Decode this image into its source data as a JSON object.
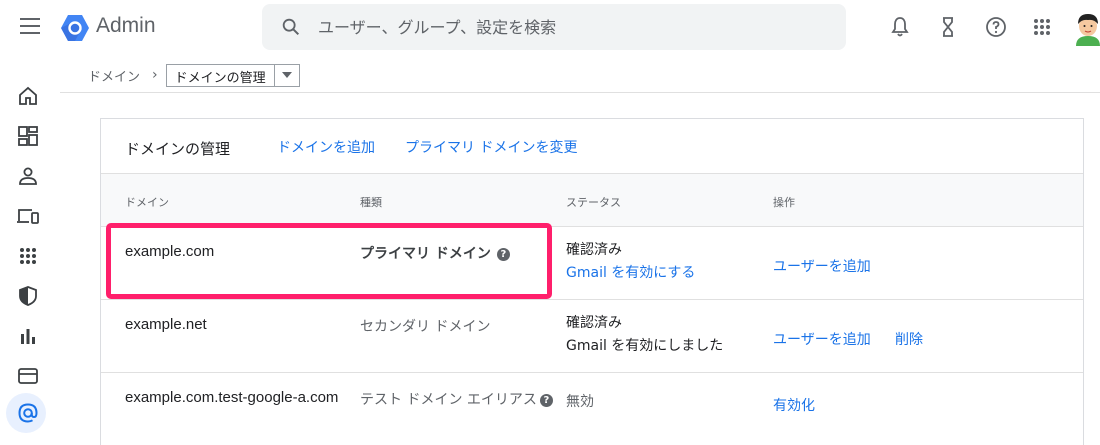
{
  "header": {
    "app_title": "Admin",
    "search_placeholder": "ユーザー、グループ、設定を検索"
  },
  "breadcrumb": {
    "parent": "ドメイン",
    "separator": "›",
    "current": "ドメインの管理"
  },
  "card": {
    "title": "ドメインの管理",
    "add_domain_link": "ドメインを追加",
    "change_primary_link": "プライマリ ドメインを変更"
  },
  "columns": {
    "domain": "ドメイン",
    "type": "種類",
    "status": "ステータス",
    "actions": "操作"
  },
  "rows": [
    {
      "domain": "example.com",
      "type": "プライマリ ドメイン",
      "status": "確認済み",
      "status_link": "Gmail を有効にする",
      "action1": "ユーザーを追加"
    },
    {
      "domain": "example.net",
      "type": "セカンダリ ドメイン",
      "status": "確認済み",
      "status_sub": "Gmail を有効にしました",
      "action1": "ユーザーを追加",
      "action2": "削除"
    },
    {
      "domain": "example.com.test-google-a.com",
      "type": "テスト ドメイン エイリアス",
      "status": "無効",
      "action1": "有効化"
    }
  ],
  "help_glyph": "?",
  "colors": {
    "link": "#1a73e8",
    "highlight": "#ff1f6b",
    "icon": "#5f6368"
  }
}
